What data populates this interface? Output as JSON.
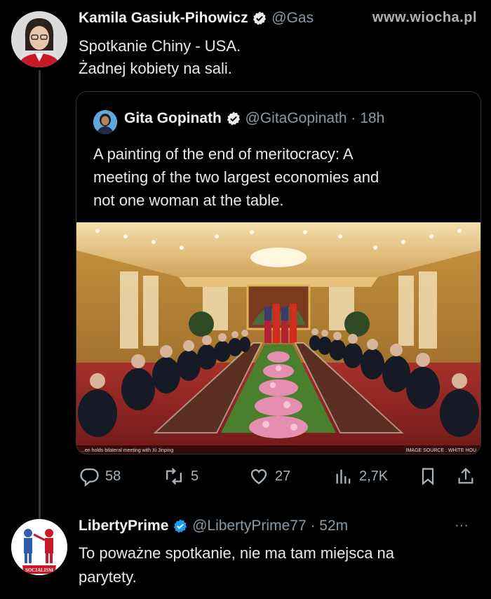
{
  "watermark": "www.wiocha.pl",
  "main_tweet": {
    "author_name": "Kamila Gasiuk-Pihowicz",
    "author_handle": "@Gas",
    "text_line1": "Spotkanie Chiny - USA.",
    "text_line2": "Żadnej kobiety na sali."
  },
  "quoted_tweet": {
    "author_name": "Gita Gopinath",
    "author_handle": "@GitaGopinath",
    "time": "· 18h",
    "text_line1": "A painting of the end of meritocracy: A",
    "text_line2": "meeting of the two largest economies and",
    "text_line3": "not one woman at the table.",
    "image_caption_left": "...en holds bilateral meeting with Xi Jinping",
    "image_caption_right": "IMAGE SOURCE : WHITE HOU"
  },
  "actions": {
    "replies": "58",
    "retweets": "5",
    "likes": "27",
    "views": "2,7K"
  },
  "reply_tweet": {
    "author_name": "LibertyPrime",
    "author_handle": "@LibertyPrime77",
    "time": "· 52m",
    "more": "···",
    "text_line1": "To poważne spotkanie, nie ma tam miejsca na",
    "text_line2": "parytety.",
    "avatar_text": "SOCIALISM"
  },
  "colors": {
    "background": "#000000",
    "verified": "#e7e9ea",
    "handle": "#8b98a5",
    "border": "#2f3336"
  }
}
